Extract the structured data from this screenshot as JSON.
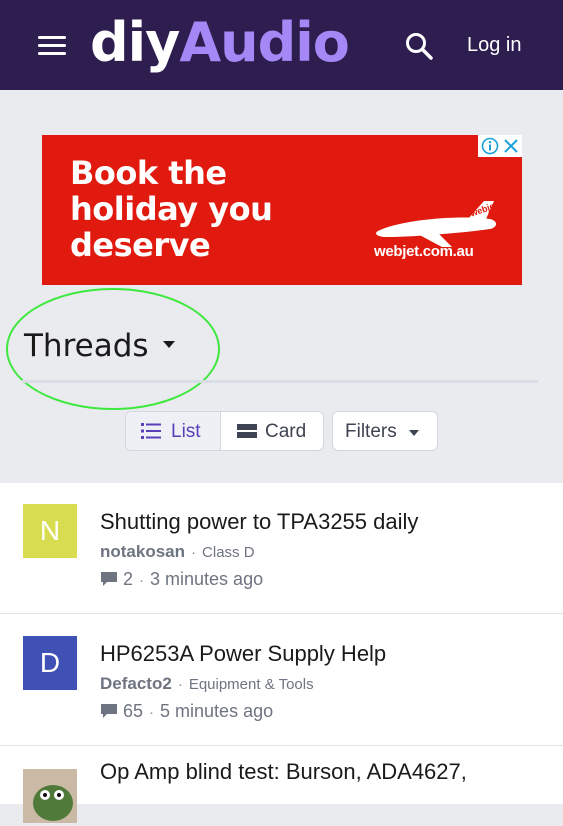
{
  "header": {
    "logo_part1": "diy",
    "logo_part2": "Audio",
    "login_label": "Log in",
    "menu_icon": "hamburger-icon",
    "search_icon": "search-icon",
    "bg_color": "#2e1e4f",
    "accent_color": "#a587f5"
  },
  "ad": {
    "line1": "Book the",
    "line2": "holiday you",
    "line3": "deserve",
    "url": "webjet.com.au",
    "brand": "webjet",
    "bg_color": "#e01a0e"
  },
  "section": {
    "title": "Threads"
  },
  "view": {
    "list_label": "List",
    "card_label": "Card",
    "filters_label": "Filters",
    "selected": "List"
  },
  "threads": [
    {
      "initial": "N",
      "avatar_color": "#d8dc51",
      "title": "Shutting power to TPA3255 daily",
      "author": "notakosan",
      "forum": "Class D",
      "replies": "2",
      "time": "3 minutes ago"
    },
    {
      "initial": "D",
      "avatar_color": "#3f51b5",
      "title": "HP6253A Power Supply Help",
      "author": "Defacto2",
      "forum": "Equipment & Tools",
      "replies": "65",
      "time": "5 minutes ago"
    },
    {
      "initial": "",
      "avatar_color": "#c9b9a5",
      "title": "Op Amp blind test: Burson, ADA4627,"
    }
  ]
}
